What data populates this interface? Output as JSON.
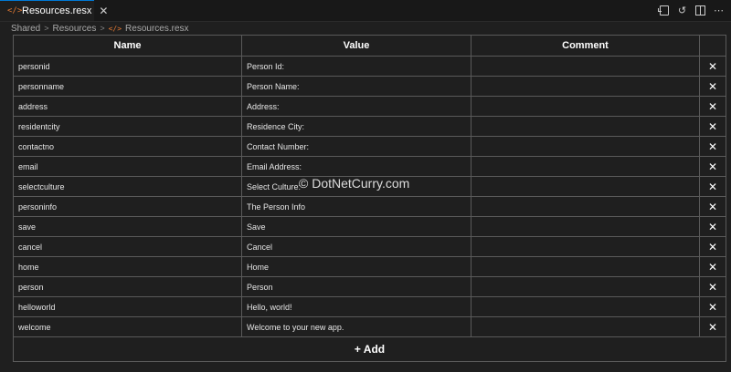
{
  "tab": {
    "title": "Resources.resx",
    "icon": "code-file-icon",
    "close_glyph": "✕"
  },
  "breadcrumb": [
    "Shared",
    "Resources",
    "Resources.resx"
  ],
  "grid": {
    "columns": [
      "Name",
      "Value",
      "Comment"
    ],
    "rows": [
      {
        "name": "personid",
        "value": "Person Id:",
        "comment": ""
      },
      {
        "name": "personname",
        "value": "Person Name:",
        "comment": ""
      },
      {
        "name": "address",
        "value": "Address:",
        "comment": ""
      },
      {
        "name": "residentcity",
        "value": "Residence City:",
        "comment": ""
      },
      {
        "name": "contactno",
        "value": "Contact Number:",
        "comment": ""
      },
      {
        "name": "email",
        "value": "Email Address:",
        "comment": ""
      },
      {
        "name": "selectculture",
        "value": "Select Culture:",
        "comment": ""
      },
      {
        "name": "personinfo",
        "value": "The Person Info",
        "comment": ""
      },
      {
        "name": "save",
        "value": "Save",
        "comment": ""
      },
      {
        "name": "cancel",
        "value": "Cancel",
        "comment": ""
      },
      {
        "name": "home",
        "value": "Home",
        "comment": ""
      },
      {
        "name": "person",
        "value": "Person",
        "comment": ""
      },
      {
        "name": "helloworld",
        "value": "Hello, world!",
        "comment": ""
      },
      {
        "name": "welcome",
        "value": "Welcome to your new app.",
        "comment": ""
      }
    ],
    "delete_glyph": "✕",
    "add_label": "+ Add"
  },
  "watermark": "© DotNetCurry.com",
  "colors": {
    "background": "#1f1f1f",
    "border": "#5a5a5a",
    "file_icon": "#e37933"
  }
}
